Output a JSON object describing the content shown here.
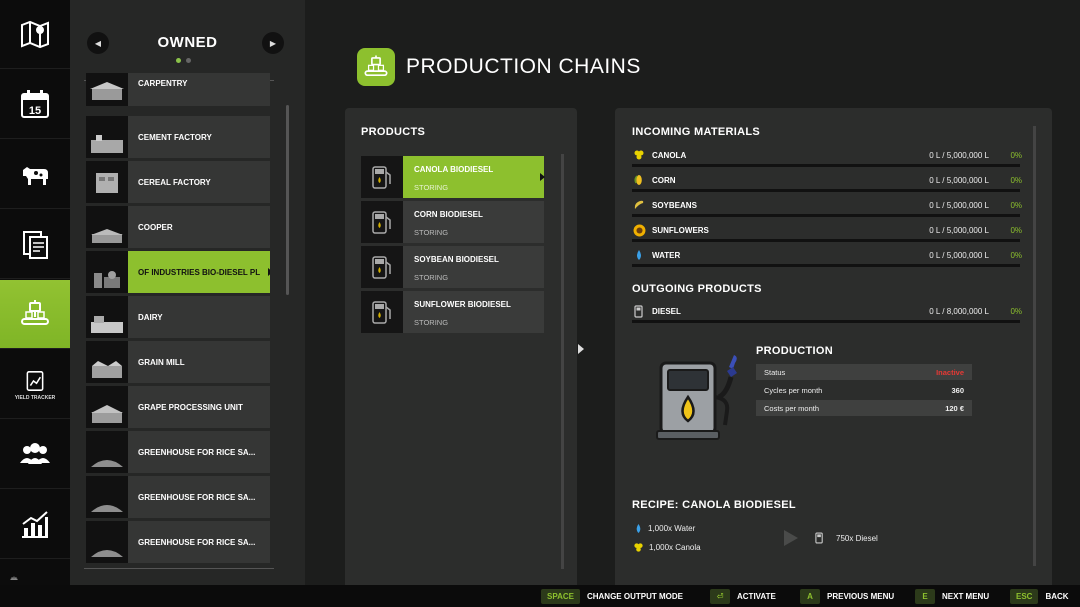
{
  "rail": {
    "items": [
      {
        "icon": "map-icon"
      },
      {
        "icon": "calendar-icon",
        "label": "15"
      },
      {
        "icon": "livestock-icon"
      },
      {
        "icon": "contracts-icon"
      },
      {
        "icon": "production-icon"
      },
      {
        "icon": "yield-tracker-icon",
        "label": "YIELD TRACKER"
      },
      {
        "icon": "workers-icon"
      },
      {
        "icon": "statistics-icon"
      },
      {
        "icon": "more-icon"
      }
    ],
    "active_index": 4
  },
  "owned": {
    "title": "OWNED",
    "items": [
      {
        "label": "CARPENTRY"
      },
      {
        "label": "CEMENT FACTORY"
      },
      {
        "label": "CEREAL FACTORY"
      },
      {
        "label": "COOPER"
      },
      {
        "label": "OF INDUSTRIES BIO-DIESEL PL"
      },
      {
        "label": "DAIRY"
      },
      {
        "label": "GRAIN MILL"
      },
      {
        "label": "GRAPE PROCESSING UNIT"
      },
      {
        "label": "GREENHOUSE FOR RICE SA..."
      },
      {
        "label": "GREENHOUSE FOR RICE SA..."
      },
      {
        "label": "GREENHOUSE FOR RICE SA..."
      }
    ],
    "selected_index": 4
  },
  "header": {
    "title": "PRODUCTION CHAINS"
  },
  "products": {
    "title": "PRODUCTS",
    "items": [
      {
        "name": "CANOLA BIODIESEL",
        "state": "STORING"
      },
      {
        "name": "CORN BIODIESEL",
        "state": "STORING"
      },
      {
        "name": "SOYBEAN BIODIESEL",
        "state": "STORING"
      },
      {
        "name": "SUNFLOWER BIODIESEL",
        "state": "STORING"
      }
    ],
    "selected_index": 0
  },
  "incoming": {
    "title": "INCOMING MATERIALS",
    "items": [
      {
        "icon": "canola-icon",
        "name": "CANOLA",
        "amount": "0 L / 5,000,000 L",
        "pct": "0%"
      },
      {
        "icon": "corn-icon",
        "name": "CORN",
        "amount": "0 L / 5,000,000 L",
        "pct": "0%"
      },
      {
        "icon": "soybean-icon",
        "name": "SOYBEANS",
        "amount": "0 L / 5,000,000 L",
        "pct": "0%"
      },
      {
        "icon": "sunflower-icon",
        "name": "SUNFLOWERS",
        "amount": "0 L / 5,000,000 L",
        "pct": "0%"
      },
      {
        "icon": "water-icon",
        "name": "WATER",
        "amount": "0 L / 5,000,000 L",
        "pct": "0%"
      }
    ]
  },
  "outgoing": {
    "title": "OUTGOING PRODUCTS",
    "items": [
      {
        "icon": "diesel-icon",
        "name": "DIESEL",
        "amount": "0 L / 8,000,000 L",
        "pct": "0%"
      }
    ]
  },
  "production": {
    "title": "PRODUCTION",
    "status_label": "Status",
    "status_value": "Inactive",
    "cycles_label": "Cycles per month",
    "cycles_value": "360",
    "costs_label": "Costs per month",
    "costs_value": "120 €"
  },
  "recipe": {
    "title": "RECIPE: CANOLA BIODIESEL",
    "inputs": [
      "1,000x Water",
      "1,000x Canola"
    ],
    "output": "750x Diesel"
  },
  "bottombar": {
    "hints": [
      {
        "key": "SPACE",
        "label": "CHANGE OUTPUT MODE"
      },
      {
        "key": "⏎",
        "label": "ACTIVATE"
      },
      {
        "key": "A",
        "label": "PREVIOUS MENU"
      },
      {
        "key": "E",
        "label": "NEXT MENU"
      },
      {
        "key": "ESC",
        "label": "BACK"
      }
    ]
  },
  "colors": {
    "accent": "#8dc02e",
    "inactive": "#e53935",
    "panel": "#2c2d2c"
  }
}
